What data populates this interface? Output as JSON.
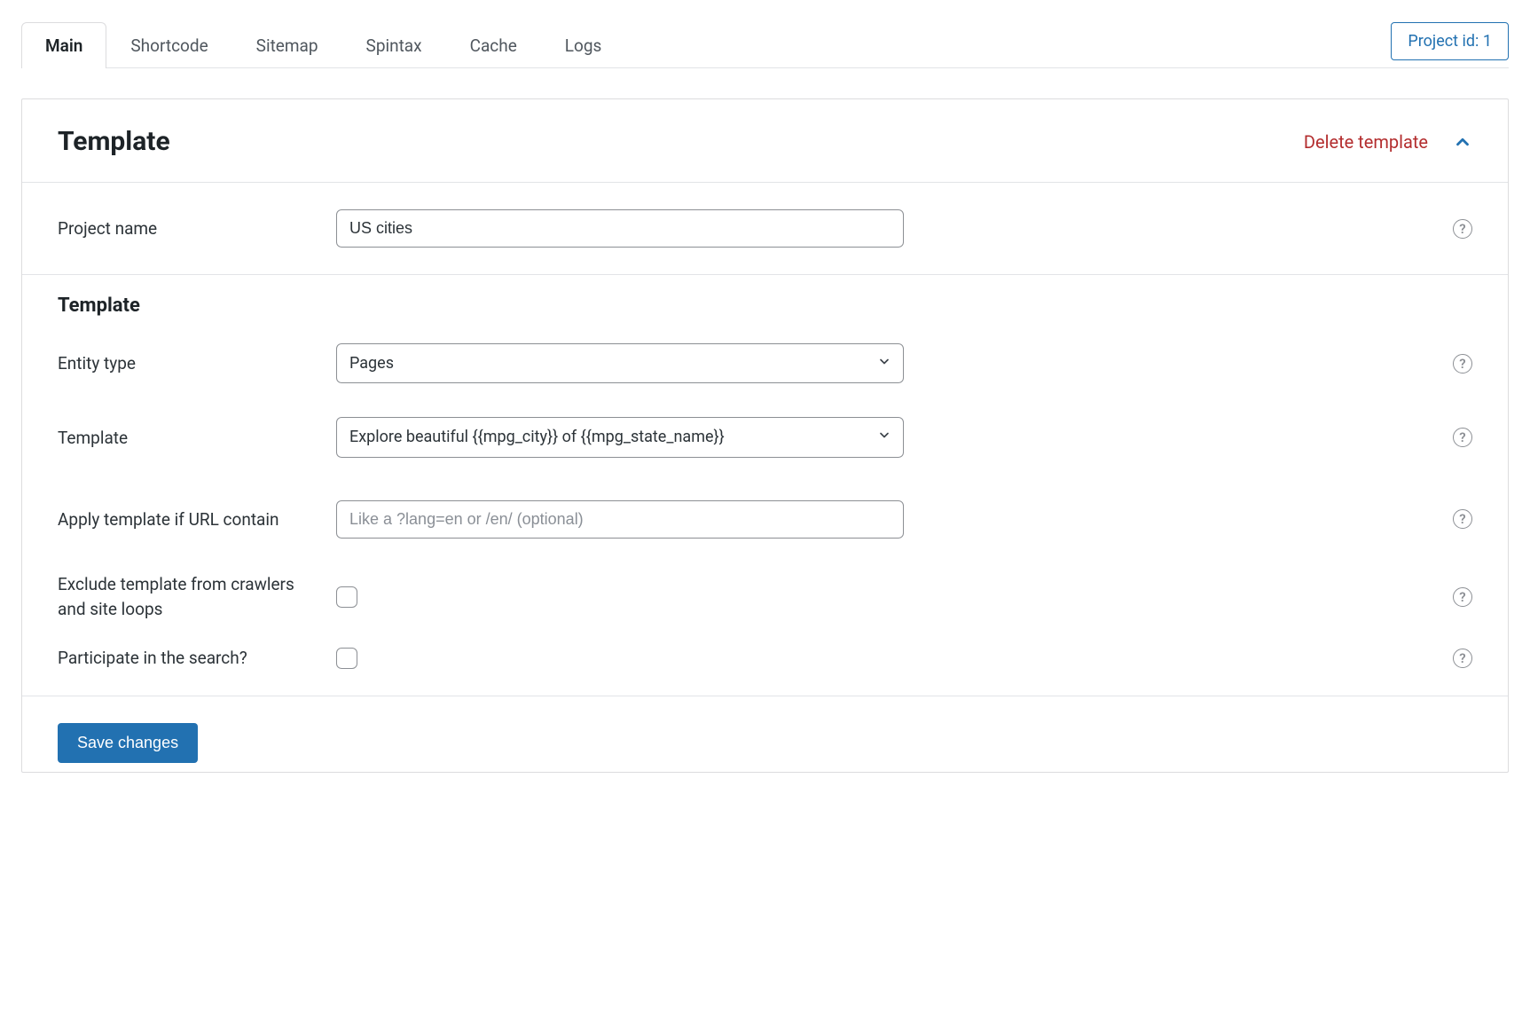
{
  "tabs": {
    "main": "Main",
    "shortcode": "Shortcode",
    "sitemap": "Sitemap",
    "spintax": "Spintax",
    "cache": "Cache",
    "logs": "Logs"
  },
  "project_id_badge": "Project id: 1",
  "panel": {
    "title": "Template",
    "delete_label": "Delete template"
  },
  "fields": {
    "project_name_label": "Project name",
    "project_name_value": "US cities",
    "section_heading": "Template",
    "entity_type_label": "Entity type",
    "entity_type_value": "Pages",
    "template_label": "Template",
    "template_value": "Explore beautiful {{mpg_city}} of {{mpg_state_name}}",
    "url_contain_label": "Apply template if URL contain",
    "url_contain_placeholder": "Like a ?lang=en or /en/ (optional)",
    "url_contain_value": "",
    "exclude_label": "Exclude template from crawlers and site loops",
    "participate_label": "Participate in the search?"
  },
  "actions": {
    "save_label": "Save changes"
  },
  "help_glyph": "?"
}
